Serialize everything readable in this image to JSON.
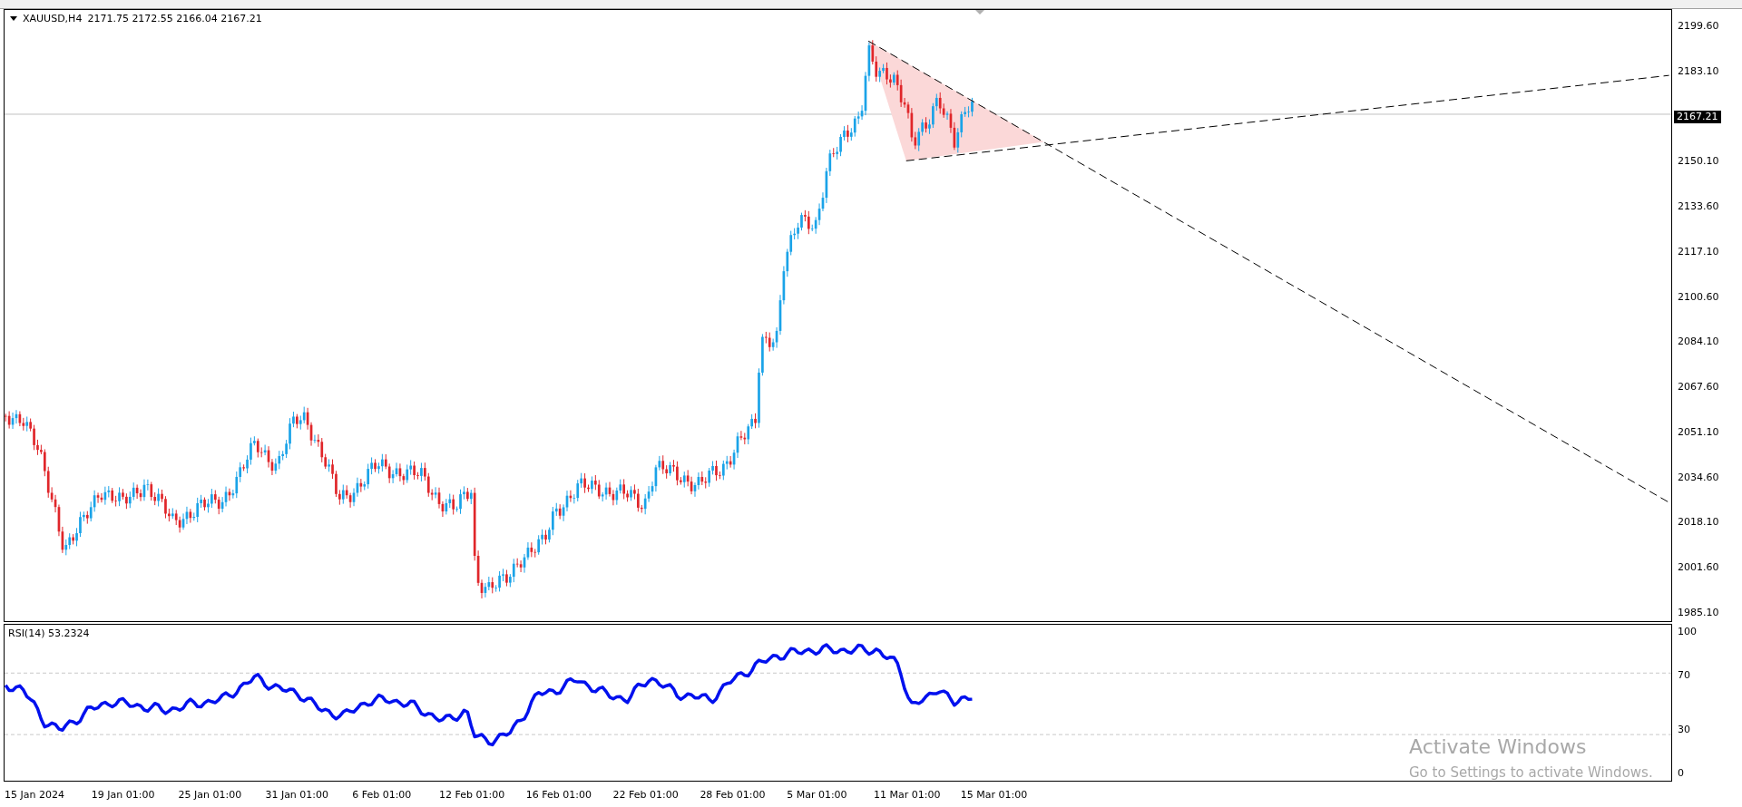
{
  "chart": {
    "symbol": "XAUUSD,H4",
    "quote": "2171.75 2172.55 2166.04 2167.21",
    "current_price": "2167.21",
    "price_axis": [
      "2199.60",
      "2183.10",
      "2150.10",
      "2133.60",
      "2117.10",
      "2100.60",
      "2084.10",
      "2067.60",
      "2051.10",
      "2034.60",
      "2018.10",
      "2001.60",
      "1985.10"
    ]
  },
  "rsi": {
    "label": "RSI(14) 53.2324",
    "axis": [
      "100",
      "70",
      "30",
      "0"
    ]
  },
  "time_axis": [
    "15 Jan 2024",
    "19 Jan 01:00",
    "25 Jan 01:00",
    "31 Jan 01:00",
    "6 Feb 01:00",
    "12 Feb 01:00",
    "16 Feb 01:00",
    "22 Feb 01:00",
    "28 Feb 01:00",
    "5 Mar 01:00",
    "11 Mar 01:00",
    "15 Mar 01:00"
  ],
  "os_notice": {
    "title": "Activate Windows",
    "subtitle": "Go to Settings to activate Windows."
  }
}
